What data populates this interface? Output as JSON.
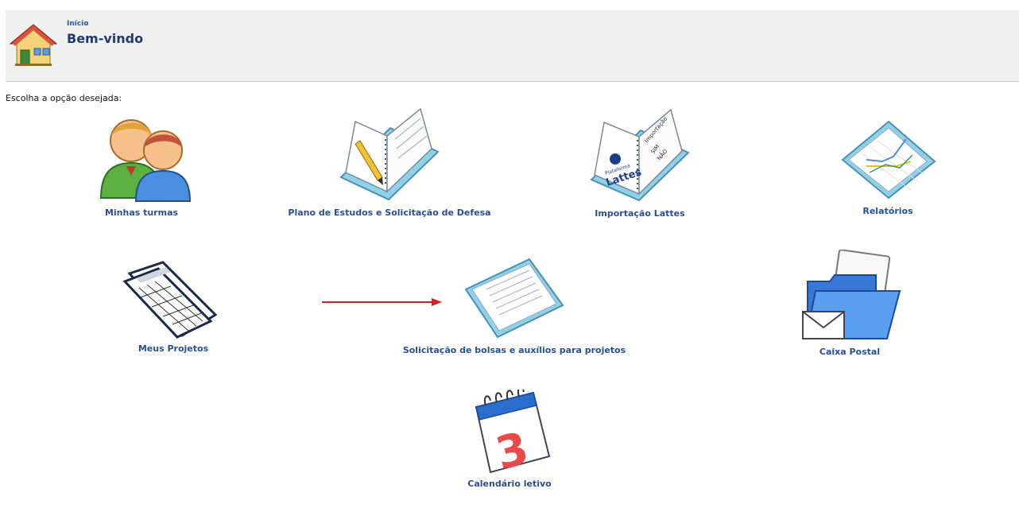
{
  "header": {
    "breadcrumb": "Início",
    "title": "Bem-vindo"
  },
  "main": {
    "prompt": "Escolha a opção desejada:",
    "options": [
      {
        "label": "Minhas turmas",
        "icon": "users-icon"
      },
      {
        "label": "Plano de Estudos e Solicitação de Defesa",
        "icon": "notebook-pen-icon"
      },
      {
        "label": "Importação Lattes",
        "icon": "lattes-import-icon"
      },
      {
        "label": "Relatórios",
        "icon": "report-chart-icon"
      },
      {
        "label": "Meus Projetos",
        "icon": "spreadsheet-documents-icon"
      },
      {
        "label": "Solicitação de bolsas e auxílios para projetos",
        "icon": "document-icon"
      },
      {
        "label": "Caixa Postal",
        "icon": "mail-folder-icon"
      },
      {
        "label": "Calendário letivo",
        "icon": "calendar-icon"
      }
    ],
    "lattes_icon_text": {
      "top": "Plataforma",
      "brand": "Lattes",
      "side": "Importação",
      "yes": "SIM",
      "no": "NÃO"
    },
    "calendar_day": "3"
  },
  "colors": {
    "link": "#2a4f8f",
    "title": "#1f3a6e",
    "header_bg": "#f0f0f0",
    "arrow": "#d42020"
  }
}
